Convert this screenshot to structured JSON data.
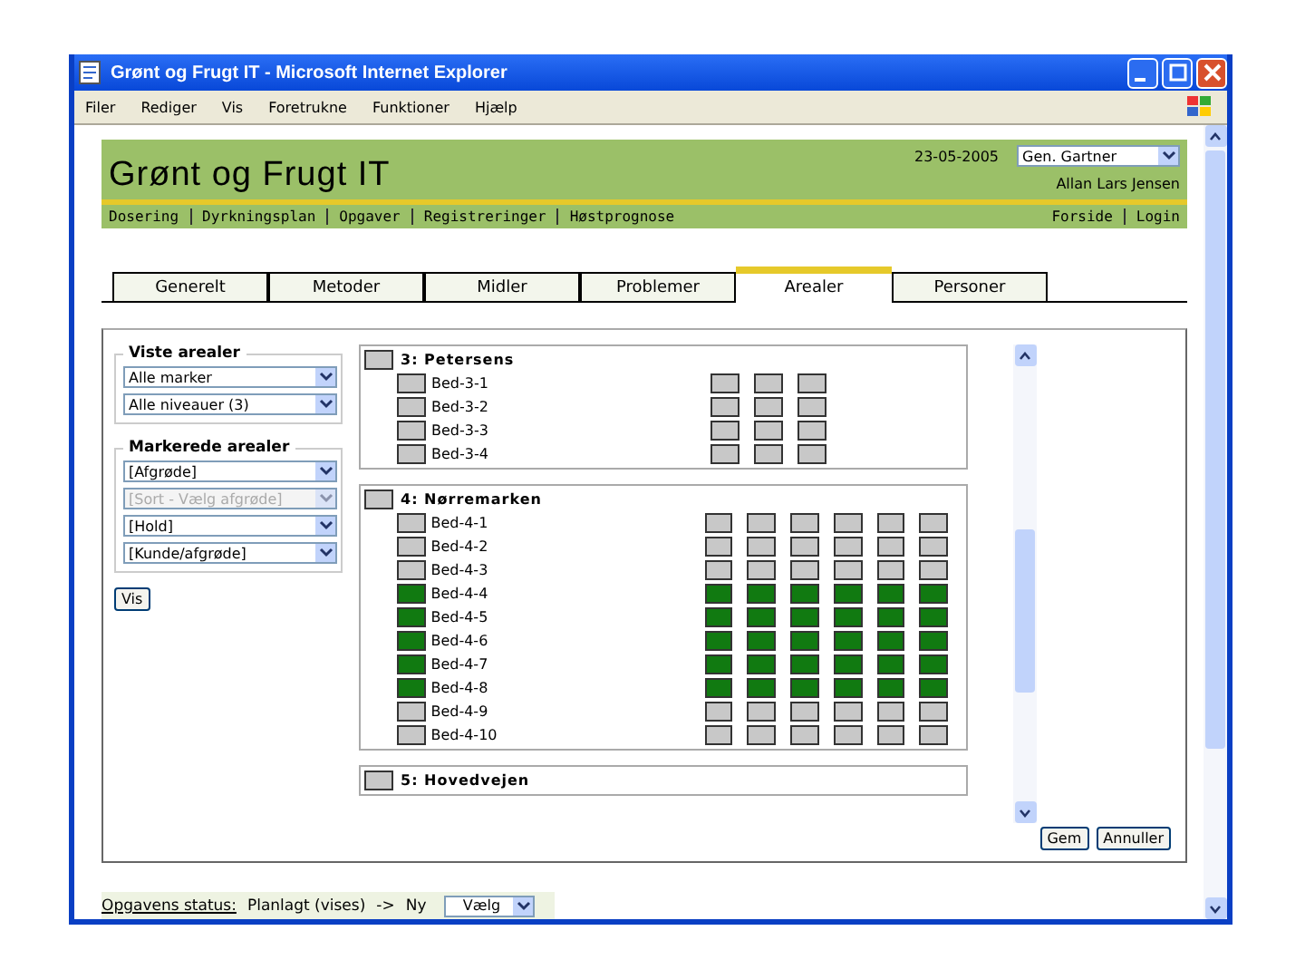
{
  "window": {
    "title": "Grønt og Frugt IT - Microsoft Internet Explorer"
  },
  "menu": [
    "Filer",
    "Rediger",
    "Vis",
    "Foretrukne",
    "Funktioner",
    "Hjælp"
  ],
  "header": {
    "title": "Grønt og Frugt IT",
    "date": "23-05-2005",
    "role": "Gen. Gartner",
    "user": "Allan Lars Jensen",
    "nav": [
      "Dosering",
      "Dyrkningsplan",
      "Opgaver",
      "Registreringer",
      "Høstprognose"
    ],
    "links": [
      "Forside",
      "Login"
    ]
  },
  "tabs": [
    {
      "label": "Generelt",
      "selected": false
    },
    {
      "label": "Metoder",
      "selected": false
    },
    {
      "label": "Midler",
      "selected": false
    },
    {
      "label": "Problemer",
      "selected": false
    },
    {
      "label": "Arealer",
      "selected": true
    },
    {
      "label": "Personer",
      "selected": false
    }
  ],
  "shown": {
    "legend": "Viste arealer",
    "selects": [
      {
        "value": "Alle marker",
        "disabled": false
      },
      {
        "value": "Alle niveauer (3)",
        "disabled": false
      }
    ]
  },
  "marked": {
    "legend": "Markerede arealer",
    "selects": [
      {
        "value": "[Afgrøde]",
        "disabled": false
      },
      {
        "value": "[Sort - Vælg afgrøde]",
        "disabled": true
      },
      {
        "value": "[Hold]",
        "disabled": false
      },
      {
        "value": "[Kunde/afgrøde]",
        "disabled": false
      }
    ]
  },
  "show_button": "Vis",
  "groups": [
    {
      "name": "3: Petersens",
      "marked": false,
      "beds": [
        {
          "name": "Bed-3-1",
          "marked": false,
          "cells": [
            false,
            false,
            false
          ]
        },
        {
          "name": "Bed-3-2",
          "marked": false,
          "cells": [
            false,
            false,
            false
          ]
        },
        {
          "name": "Bed-3-3",
          "marked": false,
          "cells": [
            false,
            false,
            false
          ]
        },
        {
          "name": "Bed-3-4",
          "marked": false,
          "cells": [
            false,
            false,
            false
          ]
        }
      ]
    },
    {
      "name": "4: Nørremarken",
      "marked": false,
      "beds": [
        {
          "name": "Bed-4-1",
          "marked": false,
          "cells": [
            false,
            false,
            false,
            false,
            false,
            false
          ]
        },
        {
          "name": "Bed-4-2",
          "marked": false,
          "cells": [
            false,
            false,
            false,
            false,
            false,
            false
          ]
        },
        {
          "name": "Bed-4-3",
          "marked": false,
          "cells": [
            false,
            false,
            false,
            false,
            false,
            false
          ]
        },
        {
          "name": "Bed-4-4",
          "marked": true,
          "cells": [
            true,
            true,
            true,
            true,
            true,
            true
          ]
        },
        {
          "name": "Bed-4-5",
          "marked": true,
          "cells": [
            true,
            true,
            true,
            true,
            true,
            true
          ]
        },
        {
          "name": "Bed-4-6",
          "marked": true,
          "cells": [
            true,
            true,
            true,
            true,
            true,
            true
          ]
        },
        {
          "name": "Bed-4-7",
          "marked": true,
          "cells": [
            true,
            true,
            true,
            true,
            true,
            true
          ]
        },
        {
          "name": "Bed-4-8",
          "marked": true,
          "cells": [
            true,
            true,
            true,
            true,
            true,
            true
          ]
        },
        {
          "name": "Bed-4-9",
          "marked": false,
          "cells": [
            false,
            false,
            false,
            false,
            false,
            false
          ]
        },
        {
          "name": "Bed-4-10",
          "marked": false,
          "cells": [
            false,
            false,
            false,
            false,
            false,
            false
          ]
        }
      ]
    },
    {
      "name": "5: Hovedvejen",
      "marked": false
    }
  ],
  "buttons": [
    "Gem",
    "Annuller"
  ],
  "status": {
    "label": "Opgavens status:",
    "value": "Planlagt (vises)",
    "arrow": "->",
    "next": "Ny",
    "select": "Vælg"
  }
}
